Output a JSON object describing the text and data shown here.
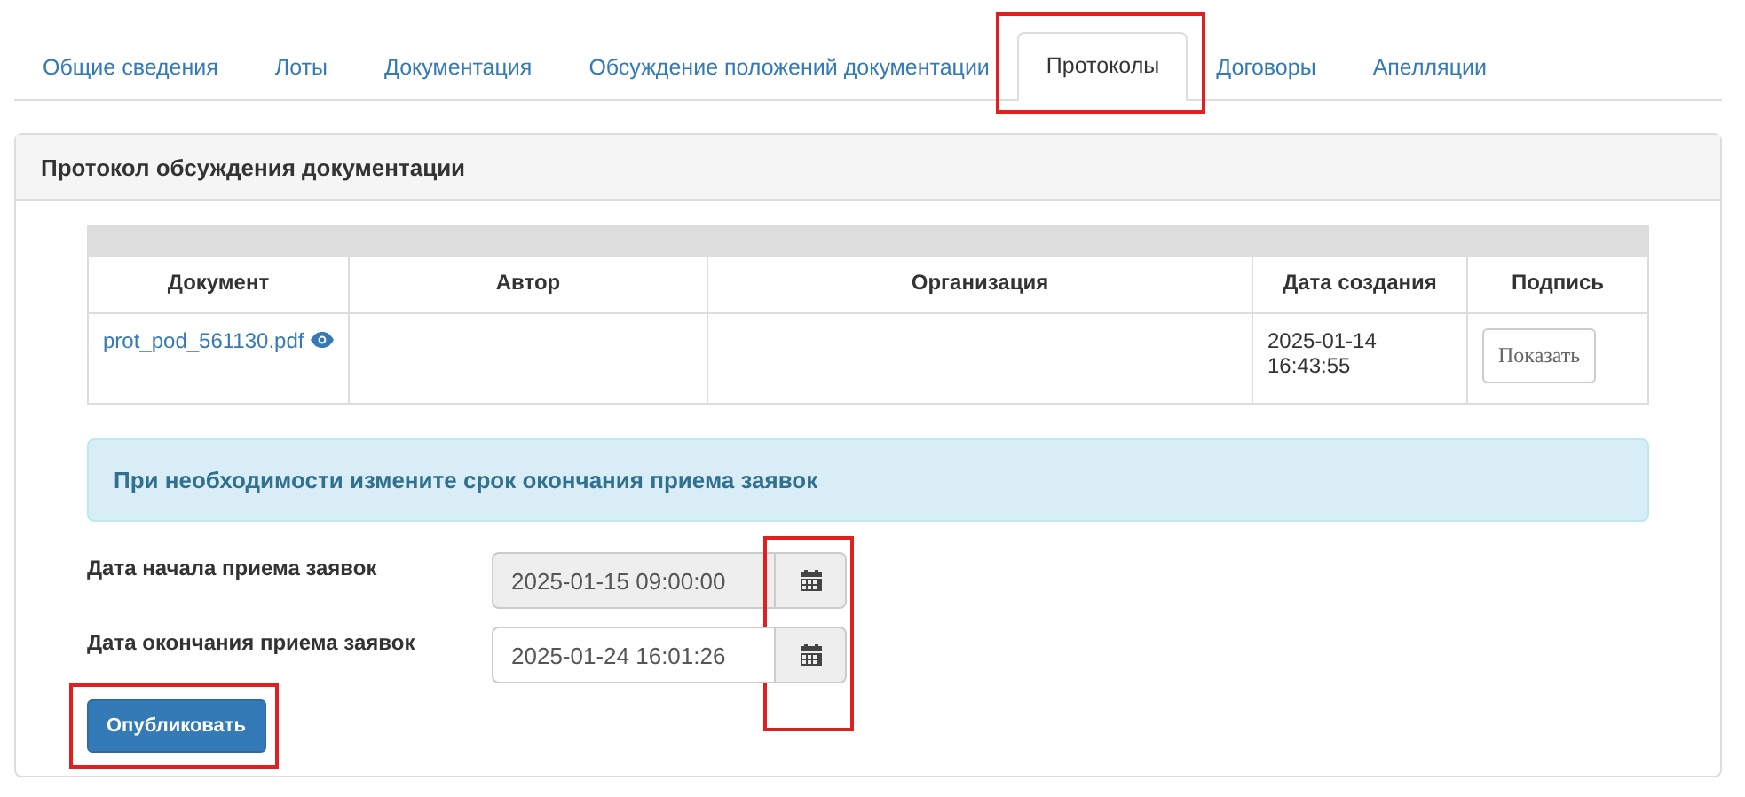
{
  "tabs": [
    {
      "label": "Общие сведения",
      "selected": false,
      "highlighted": false
    },
    {
      "label": "Лоты",
      "selected": false,
      "highlighted": false
    },
    {
      "label": "Документация",
      "selected": false,
      "highlighted": false
    },
    {
      "label": "Обсуждение положений документации",
      "selected": false,
      "highlighted": false
    },
    {
      "label": "Протоколы",
      "selected": true,
      "highlighted": true
    },
    {
      "label": "Договоры",
      "selected": false,
      "highlighted": false
    },
    {
      "label": "Апелляции",
      "selected": false,
      "highlighted": false
    }
  ],
  "panel": {
    "title": "Протокол обсуждения документации",
    "table": {
      "columns": [
        "Документ",
        "Автор",
        "Организация",
        "Дата создания",
        "Подпись"
      ],
      "rows": [
        {
          "document": "prot_pod_561130.pdf",
          "author": "",
          "organization": "",
          "created": "2025-01-14 16:43:55",
          "signature_button": "Показать"
        }
      ]
    },
    "alert": "При необходимости измените срок окончания приема заявок",
    "date_fields": [
      {
        "label": "Дата начала приема заявок",
        "value": "2025-01-15 09:00:00",
        "disabled": true
      },
      {
        "label": "Дата окончания приема заявок",
        "value": "2025-01-24 16:01:26",
        "disabled": false
      }
    ],
    "calendar_buttons_highlighted": true,
    "publish_button": {
      "label": "Опубликовать",
      "highlighted": true
    }
  }
}
